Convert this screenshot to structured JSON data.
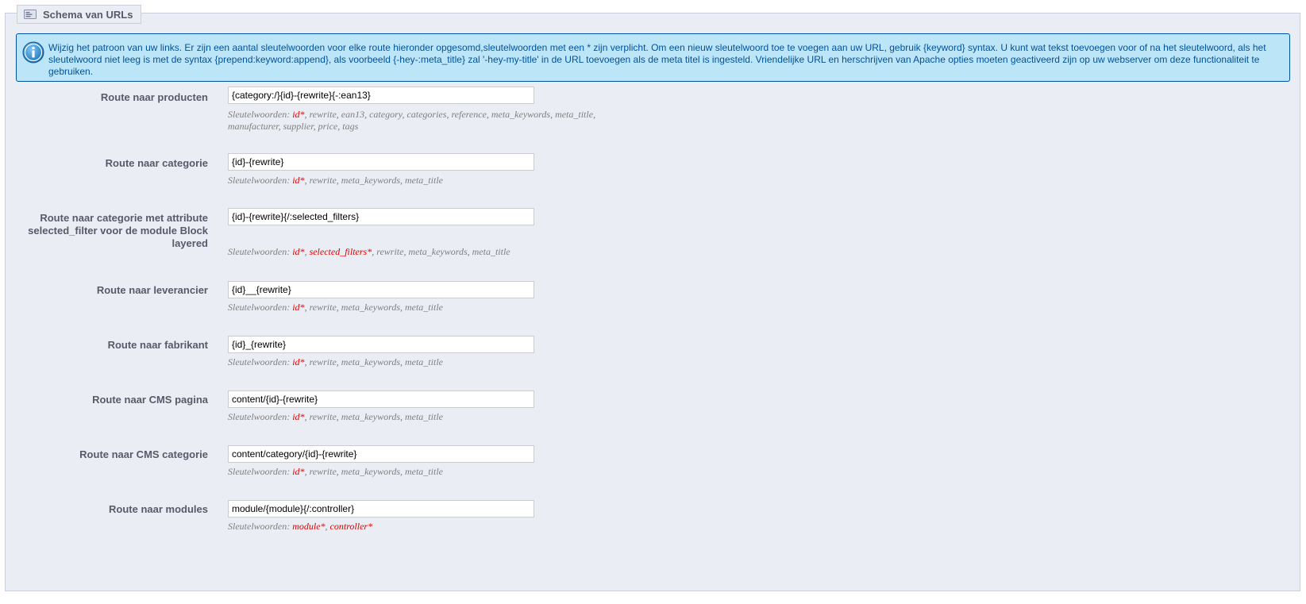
{
  "legend": {
    "title": "Schema van URLs",
    "icon": "link-icon"
  },
  "info": {
    "icon": "info-icon",
    "text": "Wijzig het patroon van uw links. Er zijn een aantal sleutelwoorden voor elke route hieronder opgesomd,sleutelwoorden met een * zijn verplicht. Om een nieuw sleutelwoord toe te voegen aan uw URL, gebruik {keyword} syntax. U kunt wat tekst toevoegen voor of na het sleutelwoord, als het sleutelwoord niet leeg is met de syntax {prepend:keyword:append}, als voorbeeld {-hey-:meta_title} zal '-hey-my-title' in de URL toevoegen als de meta titel is ingesteld. Vriendelijke URL en herschrijven van Apache opties moeten geactiveerd zijn op uw webserver om deze functionaliteit te gebruiken."
  },
  "keywords_prefix": "Sleutelwoorden: ",
  "colors": {
    "required_keyword": "#dd0000",
    "info_bg": "#bde5f8",
    "info_border": "#00529b",
    "panel_bg": "#ebedf4"
  },
  "routes": [
    {
      "label": "Route naar producten",
      "value": "{category:/}{id}-{rewrite}{-:ean13}",
      "keywords": [
        {
          "text": "id*",
          "required": true
        },
        {
          "text": "rewrite",
          "required": false
        },
        {
          "text": "ean13",
          "required": false
        },
        {
          "text": "category",
          "required": false
        },
        {
          "text": "categories",
          "required": false
        },
        {
          "text": "reference",
          "required": false
        },
        {
          "text": "meta_keywords",
          "required": false
        },
        {
          "text": "meta_title",
          "required": false
        },
        {
          "text": "manufacturer",
          "required": false
        },
        {
          "text": "supplier",
          "required": false
        },
        {
          "text": "price",
          "required": false
        },
        {
          "text": "tags",
          "required": false
        }
      ]
    },
    {
      "label": "Route naar categorie",
      "value": "{id}-{rewrite}",
      "keywords": [
        {
          "text": "id*",
          "required": true
        },
        {
          "text": "rewrite",
          "required": false
        },
        {
          "text": "meta_keywords",
          "required": false
        },
        {
          "text": "meta_title",
          "required": false
        }
      ]
    },
    {
      "label": "Route naar categorie met attribute selected_filter voor de module Block layered",
      "value": "{id}-{rewrite}{/:selected_filters}",
      "keywords": [
        {
          "text": "id*",
          "required": true
        },
        {
          "text": "selected_filters*",
          "required": true
        },
        {
          "text": "rewrite",
          "required": false
        },
        {
          "text": "meta_keywords",
          "required": false
        },
        {
          "text": "meta_title",
          "required": false
        }
      ]
    },
    {
      "label": "Route naar leverancier",
      "value": "{id}__{rewrite}",
      "keywords": [
        {
          "text": "id*",
          "required": true
        },
        {
          "text": "rewrite",
          "required": false
        },
        {
          "text": "meta_keywords",
          "required": false
        },
        {
          "text": "meta_title",
          "required": false
        }
      ]
    },
    {
      "label": "Route naar fabrikant",
      "value": "{id}_{rewrite}",
      "keywords": [
        {
          "text": "id*",
          "required": true
        },
        {
          "text": "rewrite",
          "required": false
        },
        {
          "text": "meta_keywords",
          "required": false
        },
        {
          "text": "meta_title",
          "required": false
        }
      ]
    },
    {
      "label": "Route naar CMS pagina",
      "value": "content/{id}-{rewrite}",
      "keywords": [
        {
          "text": "id*",
          "required": true
        },
        {
          "text": "rewrite",
          "required": false
        },
        {
          "text": "meta_keywords",
          "required": false
        },
        {
          "text": "meta_title",
          "required": false
        }
      ]
    },
    {
      "label": "Route naar CMS categorie",
      "value": "content/category/{id}-{rewrite}",
      "keywords": [
        {
          "text": "id*",
          "required": true
        },
        {
          "text": "rewrite",
          "required": false
        },
        {
          "text": "meta_keywords",
          "required": false
        },
        {
          "text": "meta_title",
          "required": false
        }
      ]
    },
    {
      "label": "Route naar modules",
      "value": "module/{module}{/:controller}",
      "keywords": [
        {
          "text": "module*",
          "required": true
        },
        {
          "text": "controller*",
          "required": true
        }
      ]
    }
  ]
}
